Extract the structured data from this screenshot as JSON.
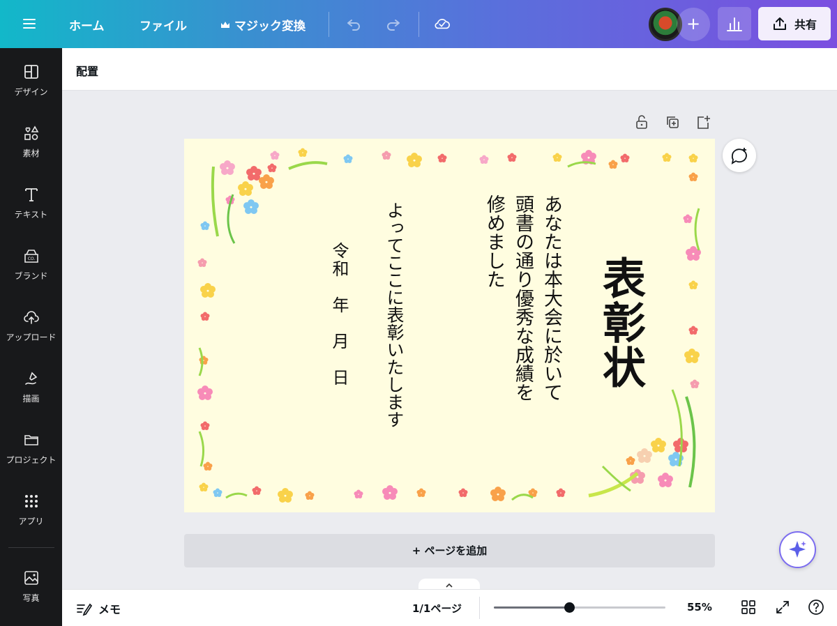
{
  "topbar": {
    "home_label": "ホーム",
    "file_label": "ファイル",
    "magic_label": "マジック変換",
    "share_label": "共有"
  },
  "sidebar": {
    "items": [
      {
        "label": "デザイン",
        "icon": "layout-icon"
      },
      {
        "label": "素材",
        "icon": "shapes-icon"
      },
      {
        "label": "テキスト",
        "icon": "text-icon"
      },
      {
        "label": "ブランド",
        "icon": "brand-icon"
      },
      {
        "label": "アップロード",
        "icon": "upload-icon"
      },
      {
        "label": "描画",
        "icon": "draw-icon"
      },
      {
        "label": "プロジェクト",
        "icon": "folder-icon"
      },
      {
        "label": "アプリ",
        "icon": "apps-icon"
      },
      {
        "label": "写真",
        "icon": "photo-icon"
      }
    ]
  },
  "toolbar": {
    "arrange_label": "配置"
  },
  "certificate": {
    "title": "表彰状",
    "body_line1": "あなたは本大会に於いて",
    "body_line2": "頭書の通り優秀な成績を",
    "body_line3": "修めました",
    "body_line4": "よってここに表彰いたします",
    "date": "令和　年　月　日",
    "background_color": "#fffde0"
  },
  "canvas": {
    "add_page_label": "+ ページを追加"
  },
  "bottombar": {
    "memo_label": "メモ",
    "page_indicator": "1/1ページ",
    "zoom_level": "55%",
    "zoom_value": 55,
    "zoom_slider_fraction": 0.44
  }
}
